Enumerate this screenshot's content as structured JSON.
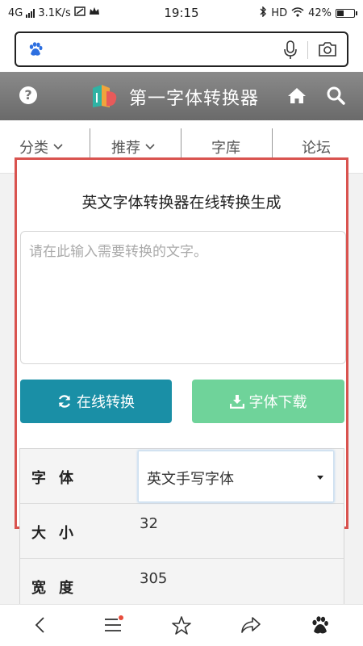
{
  "status_bar": {
    "network": "4G",
    "speed": "3.1K/s",
    "time": "19:15",
    "hd": "HD",
    "battery": "42%",
    "battery_level": 0.42
  },
  "address_bar": {
    "placeholder": "",
    "icons": [
      "baidu-paw-icon",
      "microphone-icon",
      "camera-icon"
    ]
  },
  "header": {
    "title": "第一字体转换器",
    "icons": [
      "help-icon",
      "logo-icon",
      "home-icon",
      "search-icon"
    ],
    "colors": {
      "background": "#7a7a7a",
      "text": "#ffffff"
    }
  },
  "nav": {
    "items": [
      {
        "label": "分类",
        "has_dropdown": true
      },
      {
        "label": "推荐",
        "has_dropdown": true
      },
      {
        "label": "字库",
        "has_dropdown": false
      },
      {
        "label": "论坛",
        "has_dropdown": false
      }
    ]
  },
  "converter": {
    "title": "英文字体转换器在线转换生成",
    "input_placeholder": "请在此输入需要转换的文字。",
    "input_value": "",
    "convert_label": "在线转换",
    "download_label": "字体下载",
    "colors": {
      "convert": "#1a8fa6",
      "download": "#6fd39a",
      "highlight_border": "#d9534f"
    }
  },
  "options": {
    "font": {
      "label": "字体",
      "selected": "英文手写字体"
    },
    "size": {
      "label": "大小",
      "value": "32"
    },
    "width": {
      "label": "宽度",
      "value": "305"
    }
  },
  "bottom_bar": {
    "icons": [
      "back-icon",
      "menu-icon",
      "star-icon",
      "share-icon",
      "baidu-paw-icon"
    ]
  }
}
